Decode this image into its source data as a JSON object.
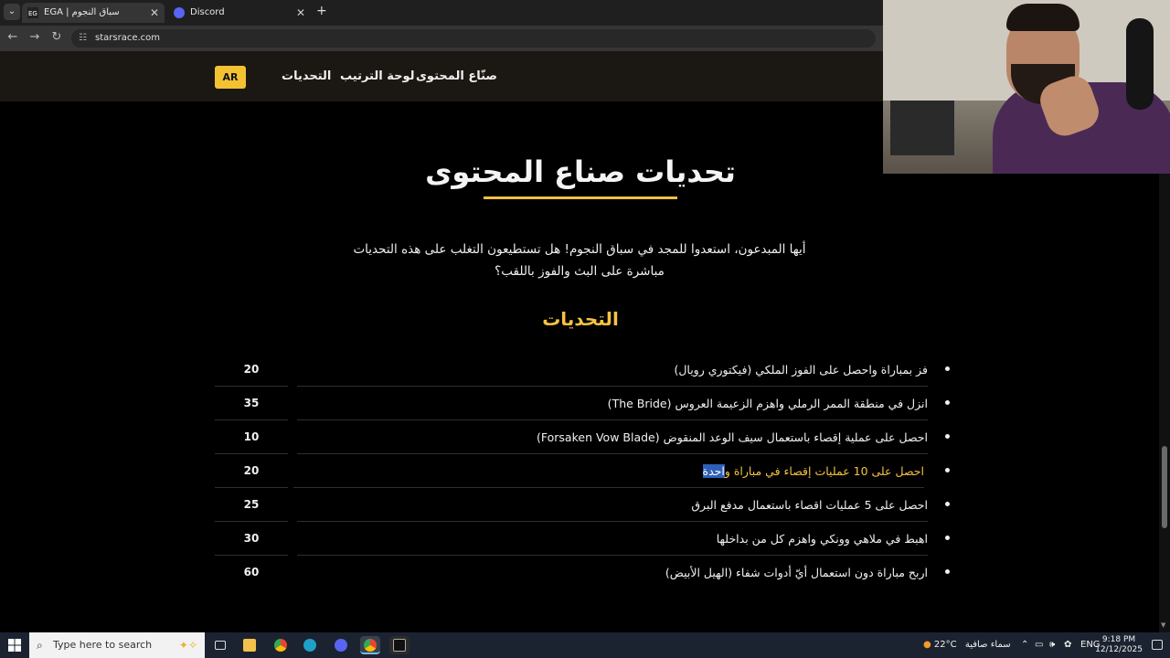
{
  "browser": {
    "tabs": [
      {
        "title": "EGA | سباق النجوم",
        "active": true
      },
      {
        "title": "Discord",
        "active": false
      }
    ],
    "url": "starsrace.com"
  },
  "header": {
    "lang": "AR",
    "nav": [
      "صنّاع المحتوى",
      "لوحة الترتيب",
      "التحديات"
    ]
  },
  "page": {
    "title": "تحديات صناع المحتوى",
    "intro": "أيها المبدعون، استعدوا للمجد في سباق النجوم! هل تستطيعون التغلب على هذه التحديات مباشرة على البث والفوز باللقب؟",
    "section_title": "التحديات",
    "challenges": [
      {
        "text": "فز بمباراة واحصل على الفوز الملكي (فيكتوري رويال)",
        "points": "20"
      },
      {
        "text": "انزل في منطقة الممر الرملي واهزم الزعيمة العروس (The Bride)",
        "points": "35"
      },
      {
        "text": "احصل على عملية إقصاء باستعمال سيف الوعد المنقوض (Forsaken Vow Blade)",
        "points": "10"
      },
      {
        "text_before": "احصل على 10 عمليات إقصاء في مباراة و",
        "text_selected": "احدة",
        "points": "20"
      },
      {
        "text": "احصل على 5 عمليات اقصاء باستعمال مدفع البرق",
        "points": "25"
      },
      {
        "text": "اهبط في ملاهي وونكي واهزم كل من بداخلها",
        "points": "30"
      },
      {
        "text": "اربح مباراة دون استعمال أيّ أدوات شفاء (الهيل الأبيض)",
        "points": "60"
      }
    ]
  },
  "taskbar": {
    "search_placeholder": "Type here to search",
    "weather_temp": "22°C",
    "weather_text": "سماء صافية",
    "language": "ENG",
    "time": "9:18 PM",
    "date": "12/12/2025"
  },
  "colors": {
    "accent": "#f5c242",
    "header_bg": "#1b1712",
    "button": "#f3c233"
  }
}
